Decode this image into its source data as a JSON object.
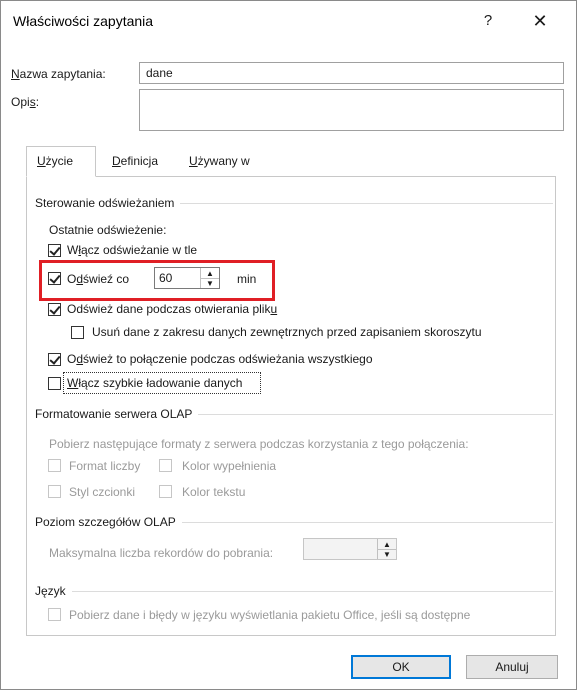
{
  "window": {
    "title": "Właściwości zapytania",
    "help_label": "?",
    "close_label": "✕"
  },
  "fields": {
    "name_label_u": "N",
    "name_label_rest": "azwa zapytania:",
    "name_value": "dane",
    "desc_label_a": "Opi",
    "desc_label_u": "s",
    "desc_label_b": ":",
    "desc_value": ""
  },
  "tabs": [
    {
      "u": "U",
      "rest": "życie"
    },
    {
      "u": "D",
      "rest": "efinicja"
    },
    {
      "u": "U",
      "rest": "żywany w"
    }
  ],
  "refresh": {
    "group_title": "Sterowanie odświeżaniem",
    "last_refresh": "Ostatnie odświeżenie:",
    "bg_a": "W",
    "bg_u": "ł",
    "bg_b": "ącz odświeżanie w tle",
    "every_a": "O",
    "every_u": "d",
    "every_b": "świeź co",
    "every_value": "60",
    "every_unit": "min",
    "onopen_a": "Odśwież dane podczas otwierania plik",
    "onopen_u": "u",
    "remove_a": "Usuń dane z zakresu dan",
    "remove_u": "y",
    "remove_b": "ch zewnętrznych przed zapisaniem skoroszytu",
    "refreshall_a": "O",
    "refreshall_u": "d",
    "refreshall_b": "śwież to połączenie podczas odświeżania wszystkiego",
    "fastload_u": "W",
    "fastload_b": "łącz szybkie ładowanie danych"
  },
  "olap_format": {
    "group_title": "Formatowanie serwera OLAP",
    "desc": "Pobierz następujące formaty z serwera podczas korzystania z tego połączenia:",
    "number_format": "Format liczby",
    "fill_color": "Kolor wypełnienia",
    "font_style": "Styl czcionki",
    "text_color": "Kolor tekstu"
  },
  "olap_detail": {
    "group_title": "Poziom szczegółów OLAP",
    "max_records": "Maksymalna liczba rekordów do pobrania:",
    "max_records_value": ""
  },
  "language": {
    "group_title": "Język",
    "office_lang": "Pobierz dane i błędy w języku wyświetlania pakietu Office, jeśli są dostępne"
  },
  "buttons": {
    "ok": "OK",
    "cancel": "Anuluj"
  },
  "colors": {
    "highlight_red": "#e01f25",
    "default_button_blue": "#0078d7"
  }
}
